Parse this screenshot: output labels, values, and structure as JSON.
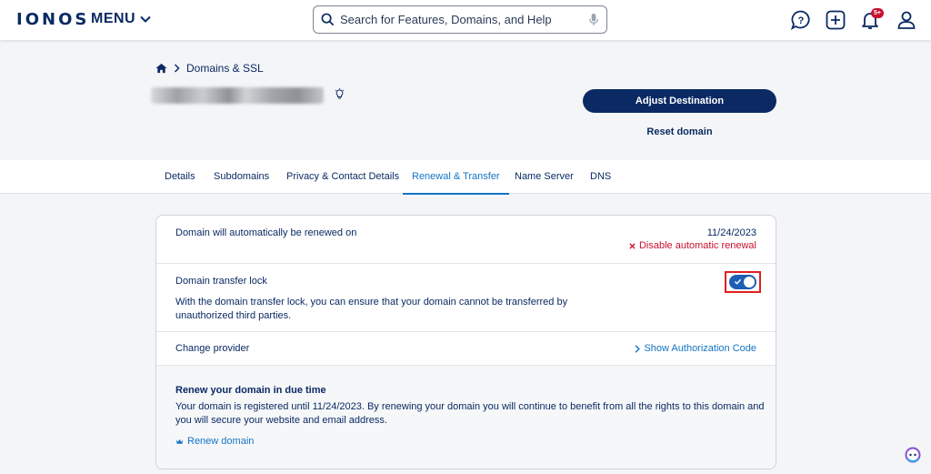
{
  "header": {
    "logo": "IONOS",
    "menu_label": "MENU",
    "search_placeholder": "Search for Features, Domains, and Help",
    "notification_badge": "5+"
  },
  "breadcrumb": {
    "label": "Domains & SSL"
  },
  "actions": {
    "adjust_destination": "Adjust Destination",
    "reset_domain": "Reset domain"
  },
  "tabs": [
    {
      "label": "Details"
    },
    {
      "label": "Subdomains"
    },
    {
      "label": "Privacy & Contact Details"
    },
    {
      "label": "Renewal & Transfer"
    },
    {
      "label": "Name Server"
    },
    {
      "label": "DNS"
    }
  ],
  "active_tab": "Renewal & Transfer",
  "renewal": {
    "title": "Domain will automatically be renewed on",
    "date": "11/24/2023",
    "disable_link": "Disable automatic renewal"
  },
  "transfer_lock": {
    "title": "Domain transfer lock",
    "description": "With the domain transfer lock, you can ensure that your domain cannot be transferred by unauthorized third parties.",
    "enabled": true
  },
  "provider": {
    "title": "Change provider",
    "auth_link": "Show Authorization Code"
  },
  "renew_info": {
    "title": "Renew your domain in due time",
    "text": "Your domain is registered until 11/24/2023. By renewing your domain you will continue to benefit from all the rights to this domain and you will secure your website and email address.",
    "link": "Renew domain"
  },
  "colors": {
    "brand": "#0b2a63",
    "link": "#1474c4",
    "danger": "#c8102e",
    "highlight": "#e0201f"
  },
  "icons": [
    "menu-chevron-icon",
    "search-icon",
    "microphone-icon",
    "help-chat-icon",
    "add-icon",
    "bell-icon",
    "user-icon",
    "home-icon",
    "breadcrumb-chevron-icon",
    "bulb-icon",
    "close-x-icon",
    "check-icon",
    "chevron-right-icon",
    "crown-icon",
    "chatbot-icon"
  ]
}
